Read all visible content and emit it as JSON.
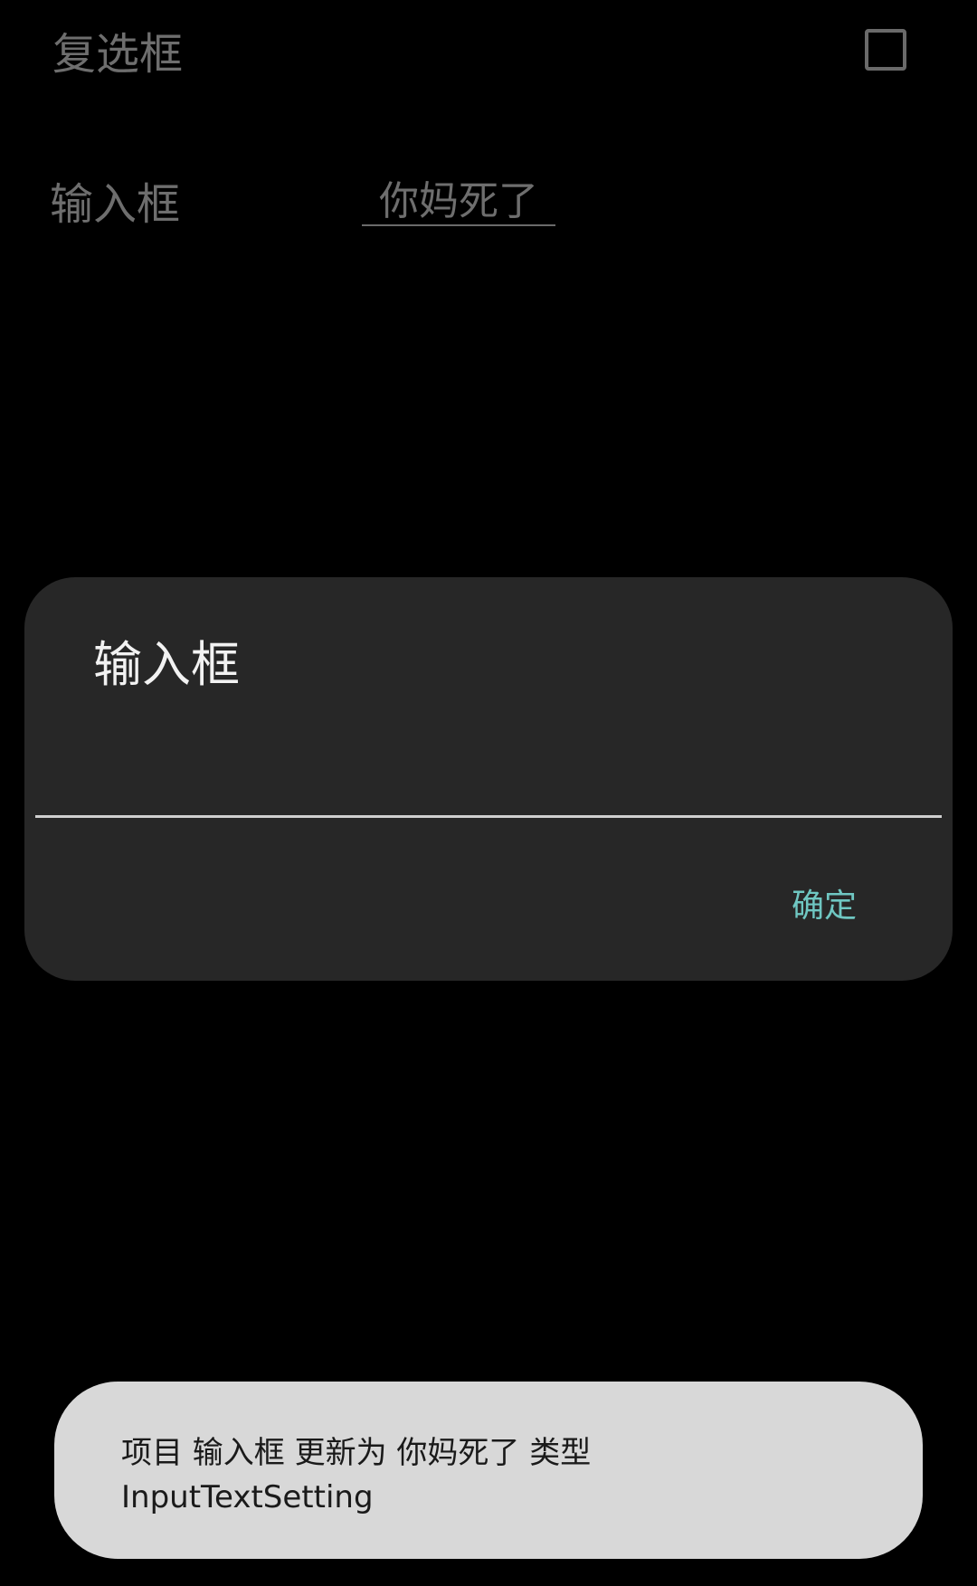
{
  "settings": {
    "checkbox_row": {
      "label": "复选框",
      "checked": false
    },
    "input_row": {
      "label": "输入框",
      "value": "你妈死了"
    }
  },
  "dialog": {
    "title": "输入框",
    "field_value": "",
    "confirm_label": "确定",
    "accent_color": "#6fc7c2"
  },
  "toast": {
    "line1": "项目 输入框 更新为 你妈死了 类型",
    "line2": "InputTextSetting"
  },
  "colors": {
    "background": "#000000",
    "dialog_background": "#272727",
    "toast_background": "#d8d8d8",
    "dim_text": "#6e6e6e"
  }
}
